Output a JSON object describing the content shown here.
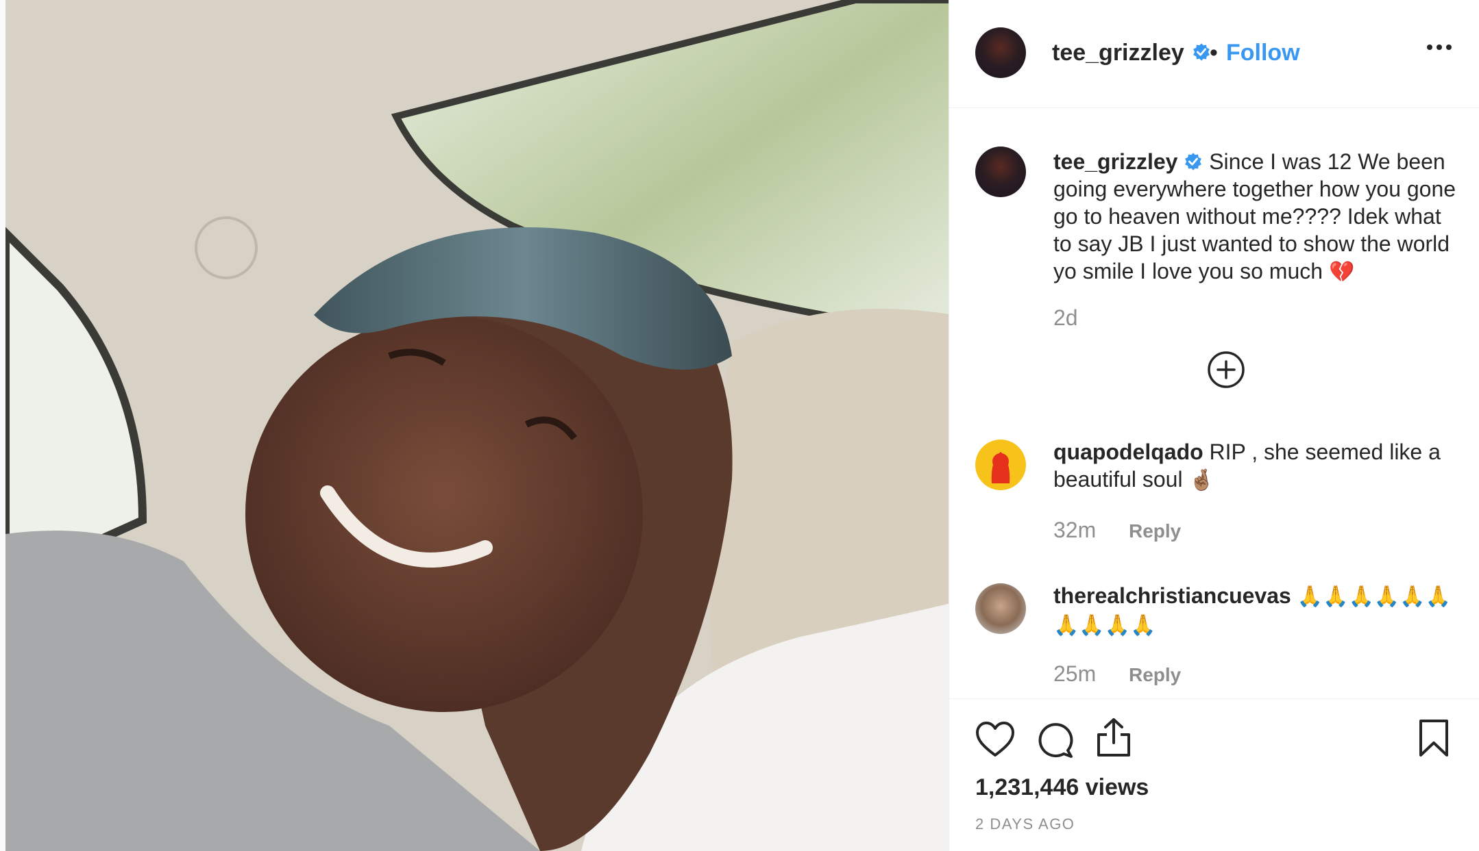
{
  "post": {
    "username": "tee_grizzley",
    "follow_label": "Follow",
    "separator": "•",
    "caption": "Since I was 12 We been going everywhere together how you gone go to heaven without me???? Idek what to say JB I just wanted to show the world yo smile I love you so much",
    "caption_emoji": "💔",
    "caption_time": "2d",
    "views": "1,231,446 views",
    "posted_ago": "2 DAYS AGO"
  },
  "comments": [
    {
      "username": "quapodelqado",
      "text": "RIP , she seemed like a beautiful soul",
      "emoji": "🤞🏽",
      "time": "32m",
      "reply_label": "Reply"
    },
    {
      "username": "therealchristiancuevas",
      "text": "",
      "emoji": "🙏🙏🙏🙏🙏🙏🙏🙏🙏🙏",
      "time": "25m",
      "reply_label": "Reply"
    }
  ],
  "icons": {
    "verified": "verified-badge-icon",
    "more": "more-options-icon",
    "load_more": "plus-circle-icon",
    "like": "heart-icon",
    "comment": "comment-icon",
    "share": "share-icon",
    "save": "bookmark-icon"
  },
  "colors": {
    "link": "#3897f0",
    "text": "#262626",
    "muted": "#8e8e8e",
    "border": "#efefef"
  }
}
